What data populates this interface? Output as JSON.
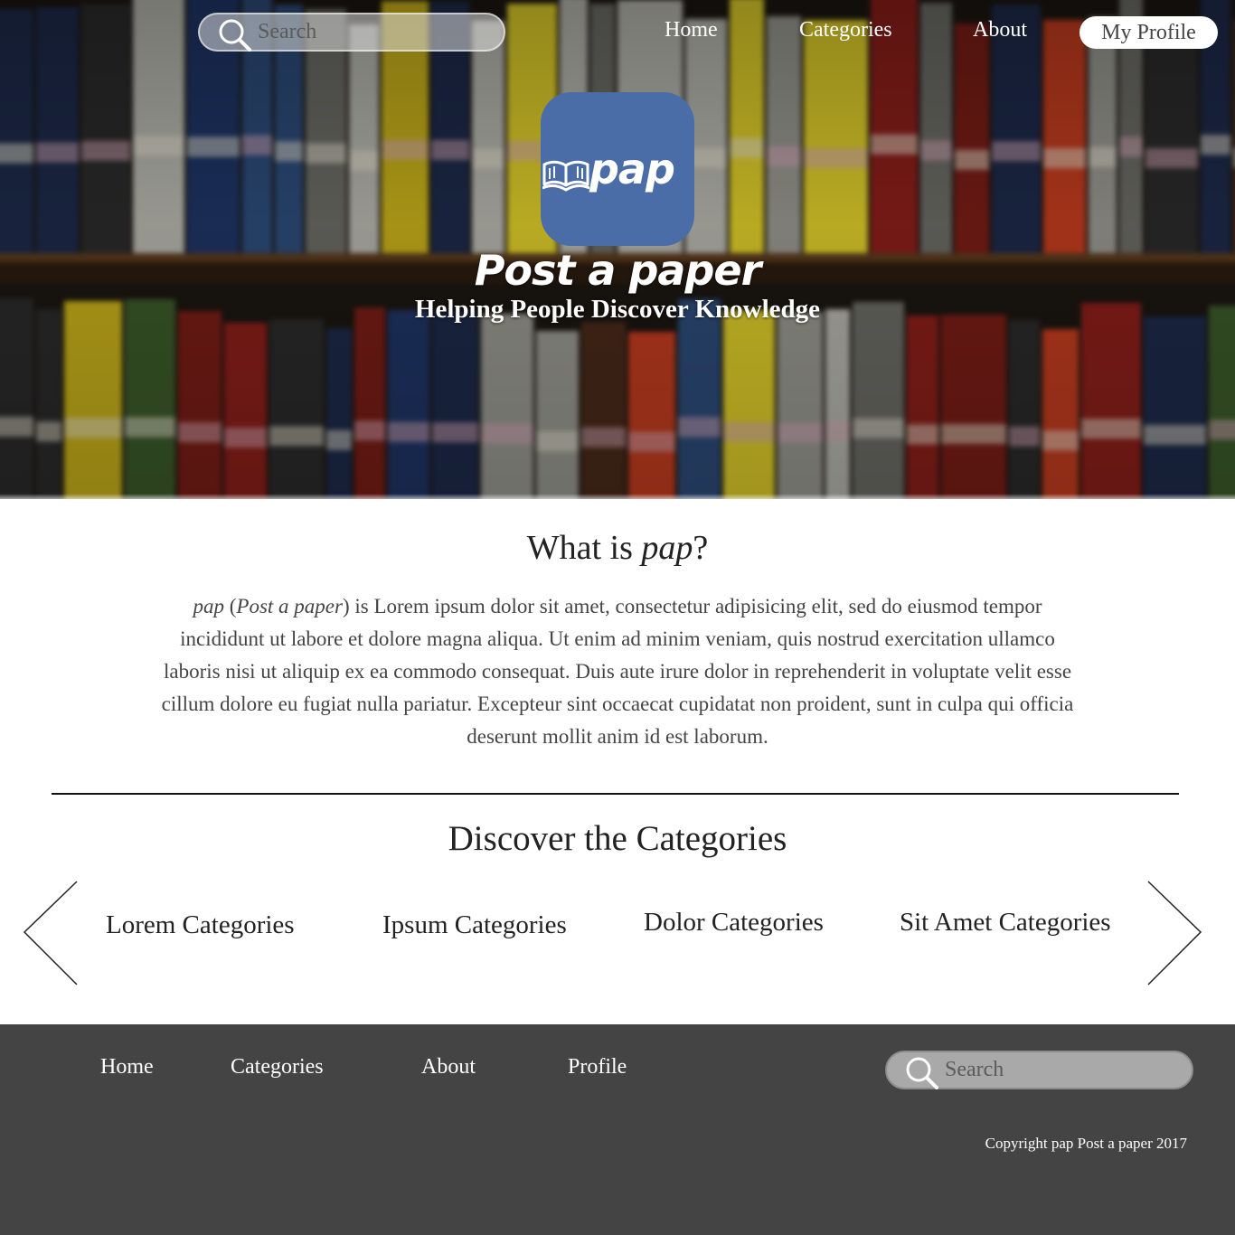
{
  "header": {
    "search_placeholder": "Search",
    "nav": [
      "Home",
      "Categories",
      "About"
    ],
    "profile_label": "My Profile"
  },
  "hero": {
    "logo_text": "pap",
    "brand": "Post a paper",
    "tagline": "Helping People Discover Knowledge"
  },
  "about": {
    "title_prefix": "What is ",
    "title_em": "pap",
    "title_suffix": "?",
    "lead_em": "pap",
    "lead_paren_em": "Post a paper",
    "body": ") is Lorem ipsum dolor sit amet, consectetur adipisicing elit, sed do eiusmod tempor incididunt ut labore et dolore magna aliqua. Ut enim ad minim veniam, quis nostrud exercitation ullamco laboris nisi ut aliquip ex ea commodo consequat. Duis aute irure dolor in reprehenderit in voluptate velit esse cillum dolore eu fugiat nulla pariatur. Excepteur sint occaecat cupidatat non proident, sunt in culpa qui officia deserunt mollit anim id est laborum."
  },
  "categories": {
    "title": "Discover the Categories",
    "items": [
      "Lorem Categories",
      "Ipsum Categories",
      "Dolor Categories",
      "Sit Amet Categories"
    ]
  },
  "footer": {
    "nav": [
      "Home",
      "Categories",
      "About",
      "Profile"
    ],
    "search_placeholder": "Search",
    "copyright": "Copyright pap Post a paper 2017"
  },
  "colors": {
    "logo_blue": "#4a6ca7",
    "footer_bg": "#444444"
  }
}
